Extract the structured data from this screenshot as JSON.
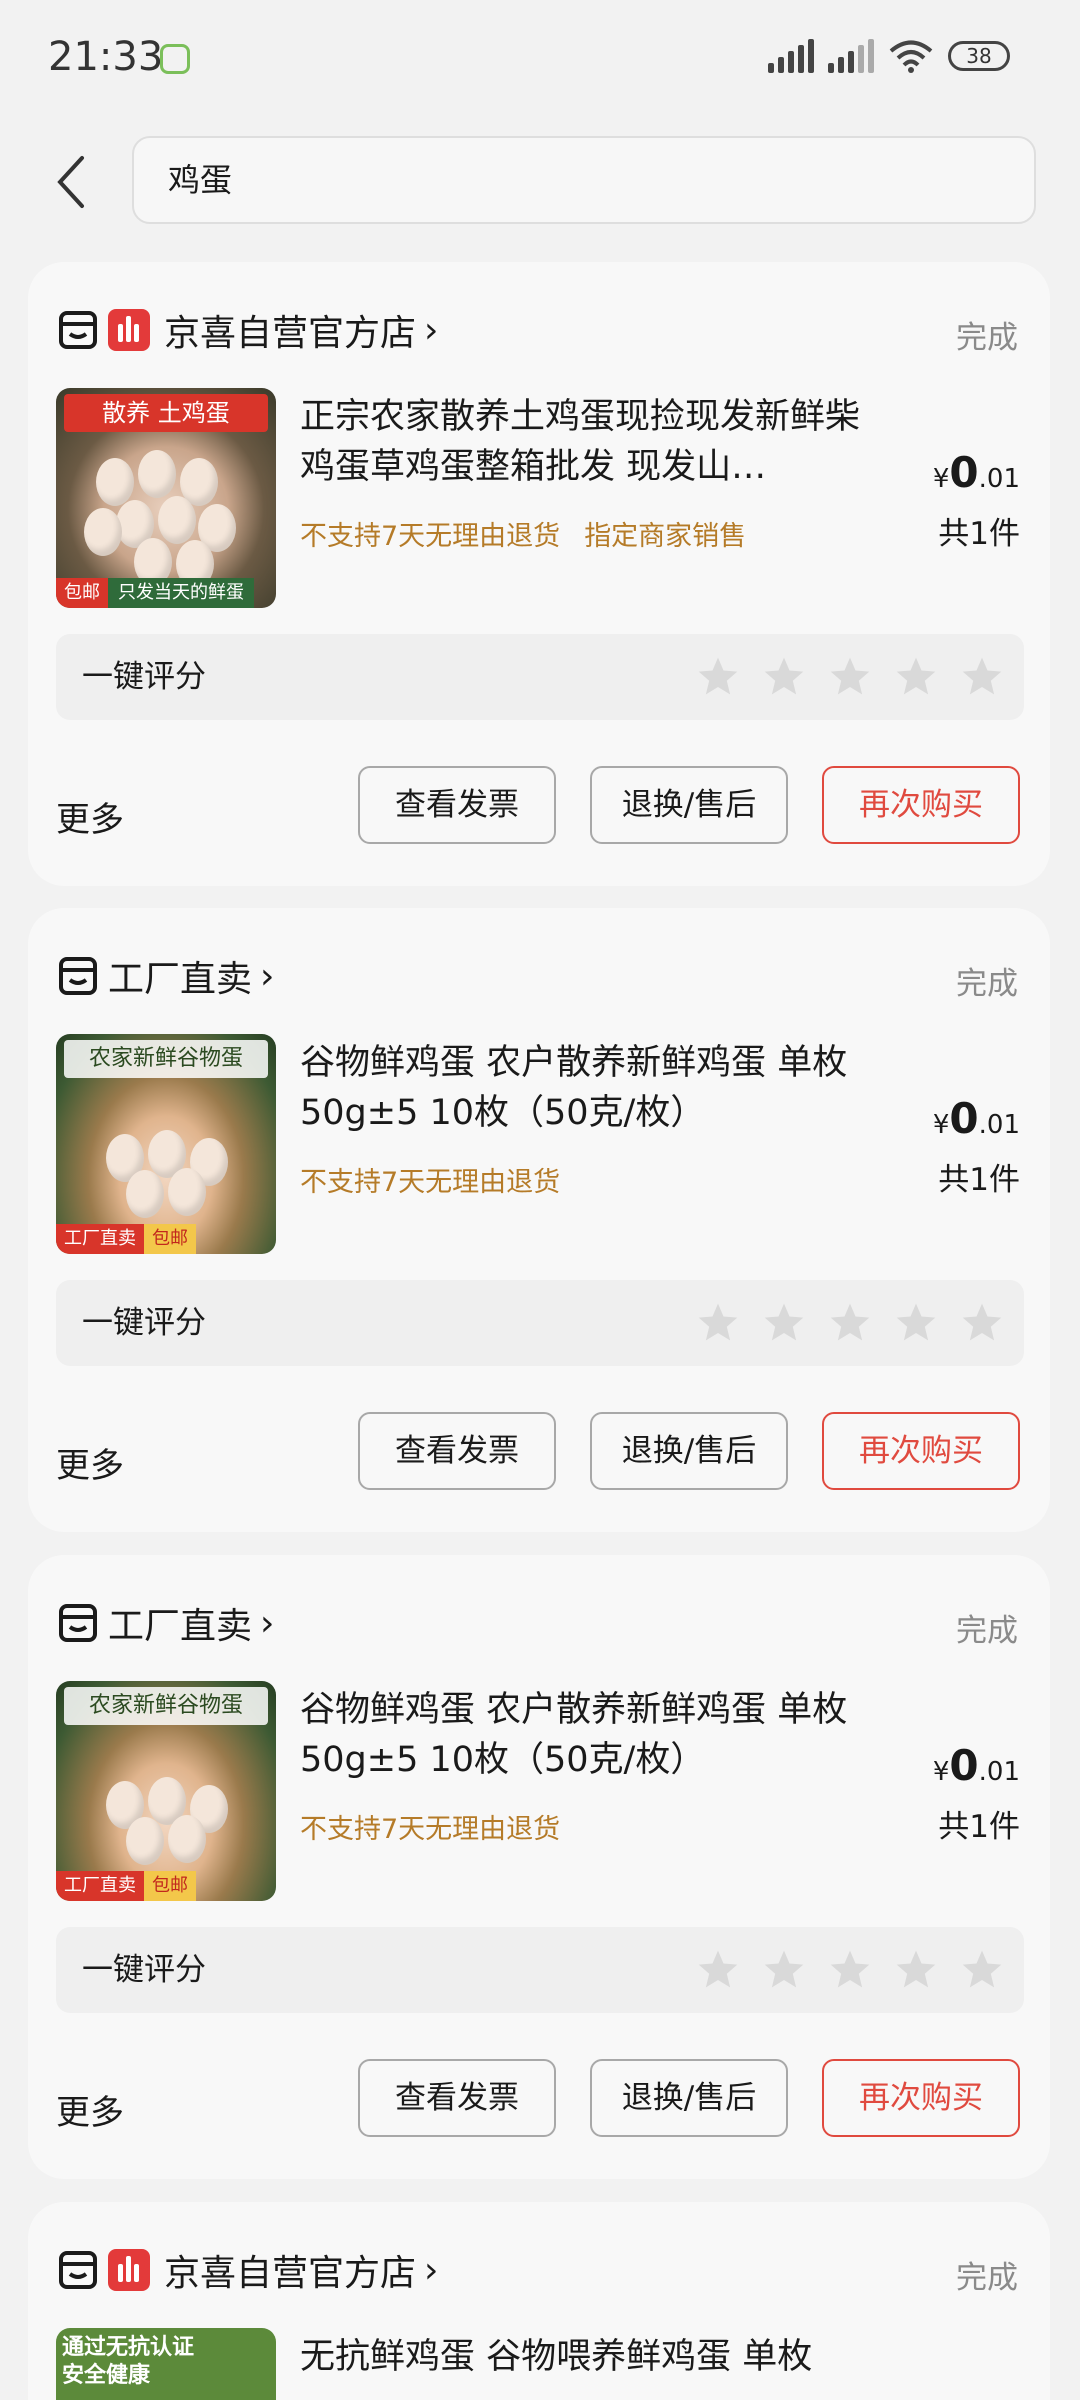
{
  "status_bar": {
    "time": "21:33",
    "battery": "38",
    "icons": [
      "signal-icon",
      "signal-icon",
      "wifi-icon",
      "battery-icon"
    ]
  },
  "search": {
    "query": "鸡蛋",
    "back_icon": "chevron-left-icon"
  },
  "orders": [
    {
      "shop_name": "京喜自营官方店",
      "shop_chevron": "›",
      "status": "完成",
      "thumb_top": "散养 土鸡蛋",
      "thumb_bottom_left": "包邮",
      "thumb_bottom_right": "只发当天的鲜蛋",
      "title": "正宗农家散养土鸡蛋现捡现发新鲜柴鸡蛋草鸡蛋整箱批发 现发山…",
      "tags": [
        "不支持7天无理由退货",
        "指定商家销售"
      ],
      "price_symbol": "¥",
      "price_int": "0",
      "price_dec": ".01",
      "qty": "共1件",
      "rating_label": "一键评分",
      "more": "更多",
      "btn_invoice": "查看发票",
      "btn_refund": "退换/售后",
      "btn_rebuy": "再次购买"
    },
    {
      "shop_name": "工厂直卖",
      "shop_chevron": "›",
      "status": "完成",
      "thumb_top": "农家新鲜谷物蛋",
      "thumb_bottom_left": "工厂直卖",
      "thumb_bottom_right": "包邮",
      "title": "谷物鲜鸡蛋 农户散养新鲜鸡蛋 单枚50g±5 10枚（50克/枚）",
      "tags": [
        "不支持7天无理由退货"
      ],
      "price_symbol": "¥",
      "price_int": "0",
      "price_dec": ".01",
      "qty": "共1件",
      "rating_label": "一键评分",
      "more": "更多",
      "btn_invoice": "查看发票",
      "btn_refund": "退换/售后",
      "btn_rebuy": "再次购买"
    },
    {
      "shop_name": "工厂直卖",
      "shop_chevron": "›",
      "status": "完成",
      "thumb_top": "农家新鲜谷物蛋",
      "thumb_bottom_left": "工厂直卖",
      "thumb_bottom_right": "包邮",
      "title": "谷物鲜鸡蛋 农户散养新鲜鸡蛋 单枚50g±5 10枚（50克/枚）",
      "tags": [
        "不支持7天无理由退货"
      ],
      "price_symbol": "¥",
      "price_int": "0",
      "price_dec": ".01",
      "qty": "共1件",
      "rating_label": "一键评分",
      "more": "更多",
      "btn_invoice": "查看发票",
      "btn_refund": "退换/售后",
      "btn_rebuy": "再次购买"
    },
    {
      "shop_name": "京喜自营官方店",
      "shop_chevron": "›",
      "status": "完成",
      "thumb_top": "通过无抗认证 安全健康",
      "title": "无抗鲜鸡蛋 谷物喂养鲜鸡蛋 单枚"
    }
  ],
  "colors": {
    "accent_red": "#e04a3f",
    "tag_orange": "#b57b28",
    "status_gray": "#8a8a8a",
    "card_bg": "#f8f8f8"
  }
}
